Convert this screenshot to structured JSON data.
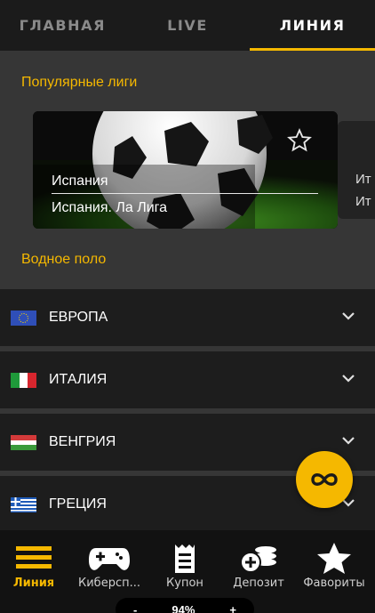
{
  "tabs": [
    {
      "label": "ГЛАВНАЯ",
      "active": false
    },
    {
      "label": "LIVE",
      "active": false
    },
    {
      "label": "ЛИНИЯ",
      "active": true
    }
  ],
  "popular": {
    "title": "Популярные лиги",
    "card": {
      "country": "Испания",
      "league": "Испания. Ла Лига"
    },
    "card2": {
      "country": "Ит",
      "league": "Ит"
    }
  },
  "sport_title": "Водное поло",
  "countries": [
    {
      "name": "ЕВРОПА",
      "flag": "eu"
    },
    {
      "name": "ИТАЛИЯ",
      "flag": "it"
    },
    {
      "name": "ВЕНГРИЯ",
      "flag": "hu"
    },
    {
      "name": "ГРЕЦИЯ",
      "flag": "gr"
    }
  ],
  "bottom_nav": [
    {
      "label": "Линия",
      "icon": "menu-lines-icon",
      "active": true
    },
    {
      "label": "Киберсп...",
      "icon": "gamepad-icon",
      "active": false
    },
    {
      "label": "Купон",
      "icon": "coupon-icon",
      "active": false
    },
    {
      "label": "Депозит",
      "icon": "coins-plus-icon",
      "active": false
    },
    {
      "label": "Фавориты",
      "icon": "star-icon",
      "active": false
    }
  ],
  "zoom": {
    "minus": "-",
    "value": "94%",
    "plus": "+"
  },
  "colors": {
    "accent": "#f5b800",
    "background": "#363636",
    "row": "#1d1d1d",
    "nav": "#121212"
  }
}
